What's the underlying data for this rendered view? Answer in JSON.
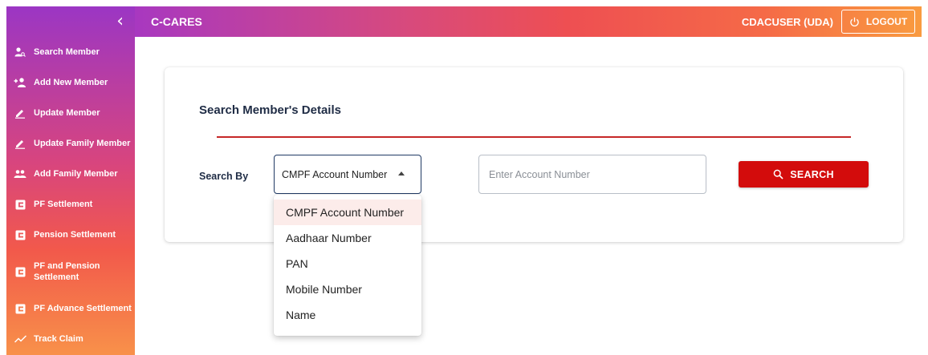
{
  "header": {
    "app_title": "C-CARES",
    "user": "CDACUSER (UDA)",
    "logout_label": "LOGOUT"
  },
  "sidebar": {
    "collapse_icon": "chevron-left-icon",
    "items": [
      {
        "label": "Search Member",
        "icon": "person-search-icon"
      },
      {
        "label": "Add New Member",
        "icon": "person-add-icon"
      },
      {
        "label": "Update Member",
        "icon": "pencil-icon"
      },
      {
        "label": "Update Family Member",
        "icon": "pencil-icon"
      },
      {
        "label": "Add Family Member",
        "icon": "group-icon"
      },
      {
        "label": "PF Settlement",
        "icon": "wallet-icon"
      },
      {
        "label": "Pension Settlement",
        "icon": "wallet-icon"
      },
      {
        "label": "PF and Pension\nSettlement",
        "icon": "wallet-icon"
      },
      {
        "label": "PF Advance Settlement",
        "icon": "wallet-icon"
      },
      {
        "label": "Track Claim",
        "icon": "trending-icon"
      }
    ]
  },
  "main": {
    "card_title": "Search Member's Details",
    "search_by_label": "Search By",
    "select": {
      "selected_value": "CMPF Account Number",
      "options": [
        "CMPF Account Number",
        "Aadhaar Number",
        "PAN",
        "Mobile Number",
        "Name"
      ]
    },
    "account_input": {
      "value": "",
      "placeholder": "Enter Account Number"
    },
    "search_button_label": "SEARCH"
  },
  "colors": {
    "accent_red": "#d30c0c",
    "divider_red": "#c62828",
    "title_navy": "#1f2c45",
    "select_border": "#203a64"
  }
}
